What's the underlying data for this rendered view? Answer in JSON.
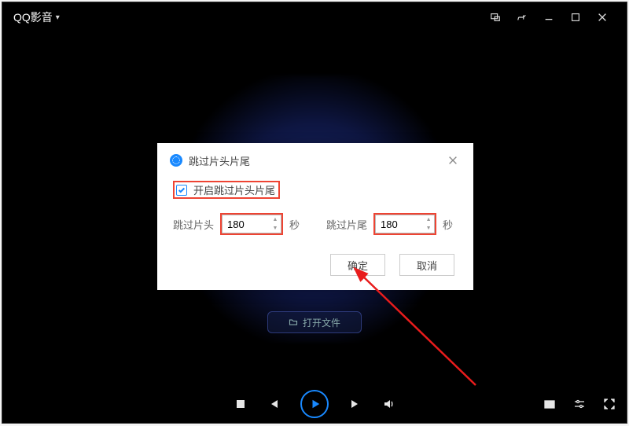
{
  "titlebar": {
    "app_name": "QQ影音"
  },
  "center_badge_label": "打开文件",
  "dialog": {
    "title": "跳过片头片尾",
    "enable_label": "开启跳过片头片尾",
    "enable_checked": true,
    "skip_head_label": "跳过片头",
    "skip_head_value": "180",
    "unit_seconds_1": "秒",
    "skip_tail_label": "跳过片尾",
    "skip_tail_value": "180",
    "unit_seconds_2": "秒",
    "ok_label": "确定",
    "cancel_label": "取消"
  }
}
